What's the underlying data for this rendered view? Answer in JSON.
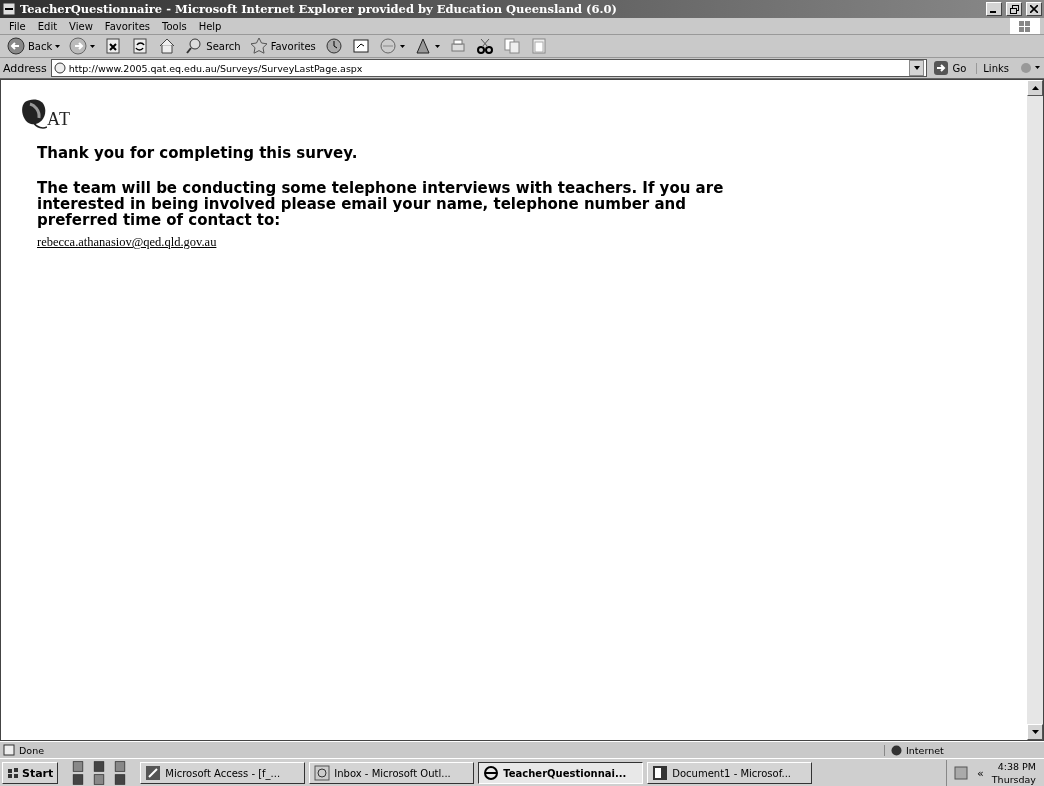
{
  "window": {
    "title": "TeacherQuestionnaire - Microsoft Internet Explorer provided by Education Queensland (6.0)"
  },
  "menu": [
    "File",
    "Edit",
    "View",
    "Favorites",
    "Tools",
    "Help"
  ],
  "toolbar": [
    {
      "label": "Back",
      "dropdown": true
    },
    {
      "dropdown": true
    },
    {
      "dropdown": false
    },
    {
      "dropdown": false
    },
    {
      "dropdown": false
    },
    {
      "label": "Search",
      "dropdown": false
    },
    {
      "label": "Favorites",
      "dropdown": false
    },
    {
      "dropdown": false
    },
    {
      "dropdown": false
    },
    {
      "dropdown": true
    },
    {
      "dropdown": true
    },
    {
      "dropdown": false
    },
    {
      "dropdown": false
    },
    {
      "dropdown": false
    },
    {
      "dropdown": false
    }
  ],
  "address": {
    "label": "Address",
    "value": "http://www.2005.qat.eq.edu.au/Surveys/SurveyLastPage.aspx",
    "go": "Go",
    "links": "Links"
  },
  "page": {
    "logo": "AT",
    "heading": "Thank you for completing this survey.",
    "message": "The team will be conducting some telephone interviews with teachers. If you are interested in being involved please email your name, telephone number and preferred time of contact to:",
    "email": "rebecca.athanasiov@qed.qld.gov.au"
  },
  "status_bar": {
    "text": "Done",
    "zone": "Internet"
  },
  "taskbar": {
    "start": "Start",
    "tasks": [
      {
        "label": "Microsoft Access - [f_...",
        "selected": false
      },
      {
        "label": "Inbox - Microsoft Outl...",
        "selected": false
      },
      {
        "label": "TeacherQuestionnai...",
        "selected": true
      },
      {
        "label": "Document1 - Microsof...",
        "selected": false
      }
    ],
    "chevron": "«",
    "time": "4:38 PM",
    "day": "Thursday"
  }
}
